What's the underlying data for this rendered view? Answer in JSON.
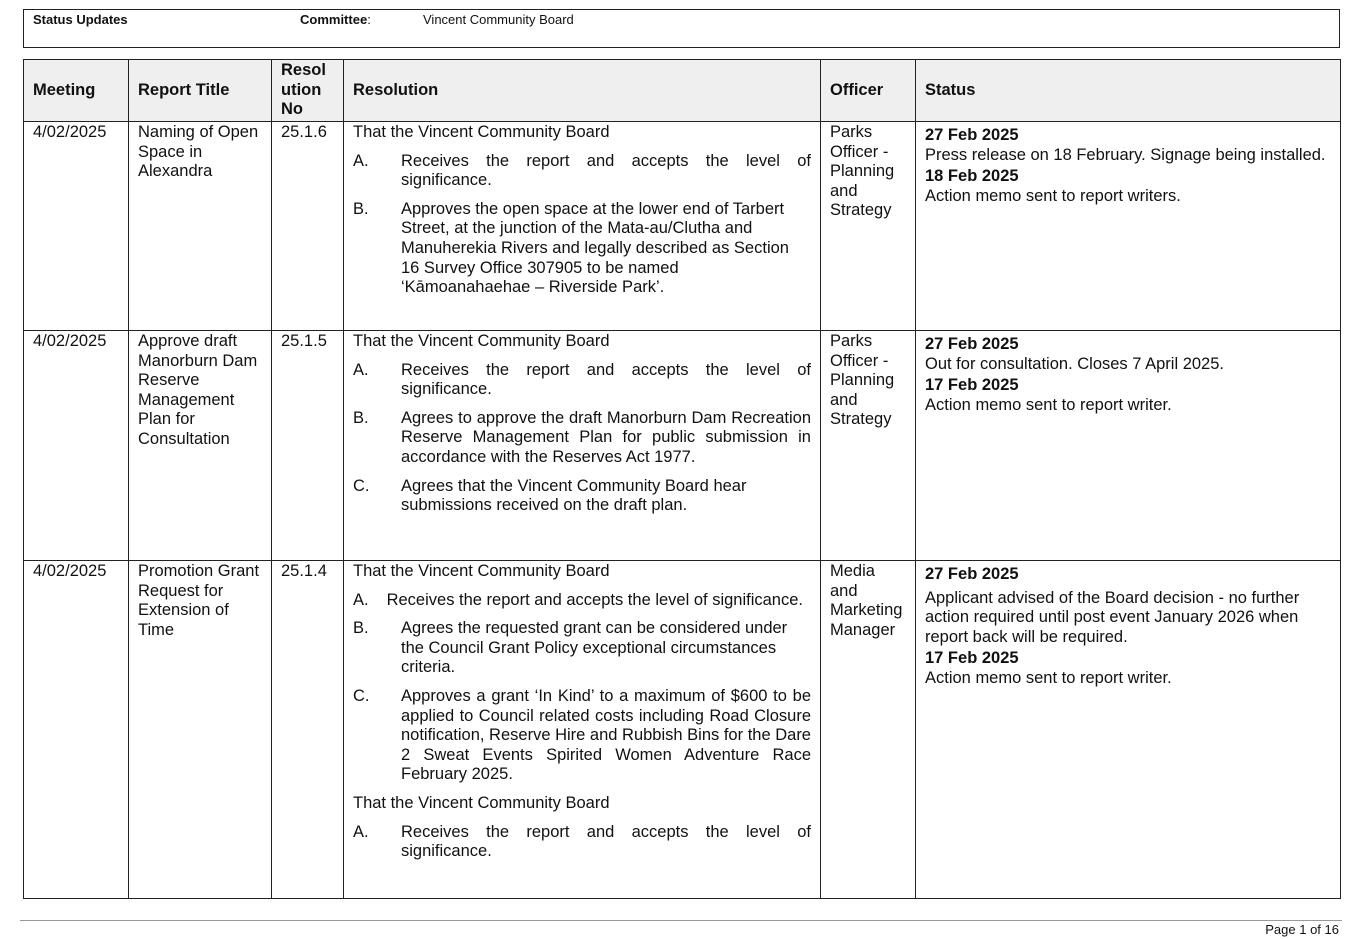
{
  "header": {
    "title": "Status Updates",
    "committee_label": "Committee",
    "committee_colon": ":",
    "committee_name": "Vincent Community Board"
  },
  "table": {
    "columns": {
      "meeting": "Meeting",
      "report_title": "Report Title",
      "resolution_no": [
        "Resol",
        "ution",
        "No"
      ],
      "resolution": "Resolution",
      "officer": "Officer",
      "status": "Status"
    },
    "rows": [
      {
        "meeting": "4/02/2025",
        "report_title": "Naming of Open Space in Alexandra",
        "resolution_no": "25.1.6",
        "intro": "That the Vincent Community Board",
        "items": [
          {
            "label": "A.",
            "text": "Receives the report and accepts the level of significance."
          },
          {
            "label": "B.",
            "text": "Approves the open space at the lower end of Tarbert Street, at the junction of the Mata-au/Clutha and Manuherekia Rivers and legally described as Section 16 Survey Office 307905 to be named ‘Kāmoanahaehae – Riverside Park’."
          }
        ],
        "officer": "Parks Officer - Planning and Strategy",
        "updates": [
          {
            "date": "27 Feb 2025",
            "text": "Press release on 18 February. Signage being installed."
          },
          {
            "date": "18 Feb 2025",
            "text": "Action memo sent to report writers."
          }
        ]
      },
      {
        "meeting": "4/02/2025",
        "report_title": "Approve draft Manorburn Dam Reserve Management Plan for Consultation",
        "resolution_no": "25.1.5",
        "intro": "That the Vincent Community Board",
        "items": [
          {
            "label": "A.",
            "text": "Receives the report and accepts the level of significance."
          },
          {
            "label": "B.",
            "text": "Agrees to approve the draft Manorburn Dam Recreation Reserve Management Plan for public submission in accordance with the Reserves Act 1977."
          },
          {
            "label": "C.",
            "text": "Agrees that the Vincent Community Board hear submissions received on the draft plan."
          }
        ],
        "officer": "Parks Officer - Planning and Strategy",
        "updates": [
          {
            "date": "27 Feb 2025",
            "text": "Out for consultation. Closes 7 April 2025."
          },
          {
            "date": "17 Feb 2025",
            "text": "Action memo sent to report writer."
          }
        ]
      },
      {
        "meeting": "4/02/2025",
        "report_title": "Promotion Grant Request for Extension of Time",
        "resolution_no": "25.1.4",
        "intro": "That the Vincent Community Board",
        "items": [
          {
            "label": "A.",
            "text": "Receives the report and accepts the level of significance."
          },
          {
            "label": "B.",
            "text": "Agrees the requested grant can be considered under the Council Grant Policy exceptional circumstances criteria."
          },
          {
            "label": "C.",
            "text": "Approves a grant ‘In Kind’ to a maximum of $600 to be applied to Council related costs including Road Closure notification, Reserve Hire and Rubbish Bins for the Dare 2 Sweat Events Spirited Women Adventure Race February 2025."
          }
        ],
        "intro2": "That the Vincent Community Board",
        "items2": [
          {
            "label": "A.",
            "text": "Receives the report and accepts the level of significance."
          }
        ],
        "officer": "Media and Marketing Manager",
        "updates": [
          {
            "date": "27 Feb 2025",
            "text": "Applicant advised of the Board decision - no further action required until post event January 2026 when report back will be required."
          },
          {
            "date": "17 Feb 2025",
            "text": "Action memo sent to report writer."
          }
        ]
      }
    ]
  },
  "footer": {
    "page": "Page 1 of 16"
  }
}
